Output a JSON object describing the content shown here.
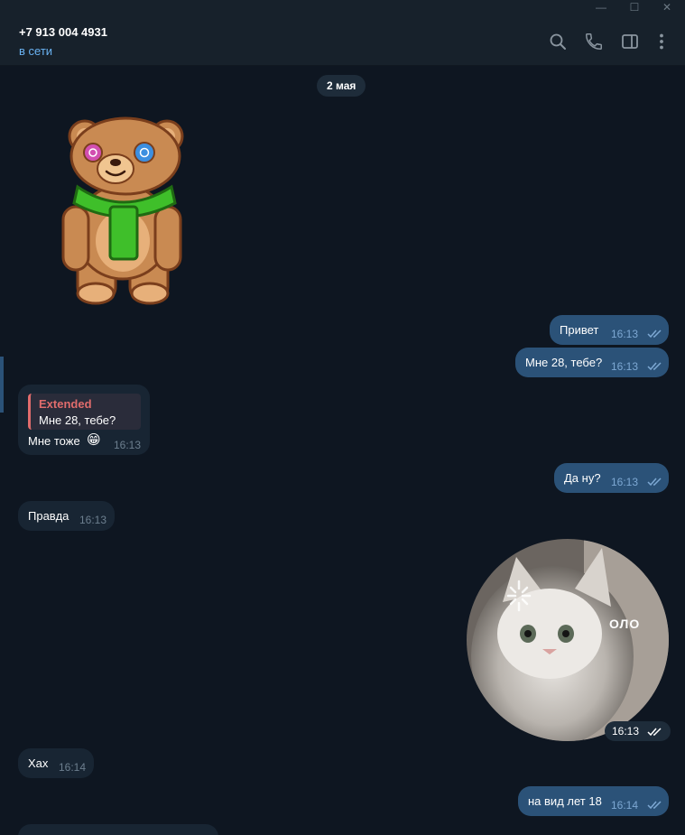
{
  "window": {
    "minimize_glyph": "—",
    "maximize_glyph": "☐",
    "close_glyph": "✕"
  },
  "header": {
    "contact_name": "+7 913 004 4931",
    "status": "в сети",
    "icons": [
      "search-icon",
      "phone-icon",
      "sidebar-toggle-icon",
      "more-icon"
    ]
  },
  "chat": {
    "date_separator": "2 мая",
    "sticker": "teddy-bear-sticker",
    "messages": [
      {
        "direction": "out",
        "text": "Привет",
        "time": "16:13"
      },
      {
        "direction": "out",
        "text": "Мне 28, тебе?",
        "time": "16:13"
      },
      {
        "direction": "in",
        "reply_to_name": "Extended",
        "reply_to_text": "Мне 28, тебе?",
        "text": "Мне тоже",
        "emoji": "😁",
        "time": "16:13"
      },
      {
        "direction": "out",
        "text": "Да ну?",
        "time": "16:13"
      },
      {
        "direction": "in",
        "text": "Правда",
        "time": "16:13"
      },
      {
        "direction": "out",
        "video_caption": "ОЛО",
        "time": "16:13"
      },
      {
        "direction": "in",
        "text": "Хах",
        "time": "16:14"
      },
      {
        "direction": "out",
        "text": "на вид лет 18",
        "time": "16:14"
      }
    ]
  },
  "colors": {
    "bg": "#0e1621",
    "header_bg": "#17212b",
    "outgoing_bubble": "#2b5278",
    "incoming_bubble": "#182533",
    "accent": "#6ab3f3",
    "reply_name": "#e06c6c"
  }
}
